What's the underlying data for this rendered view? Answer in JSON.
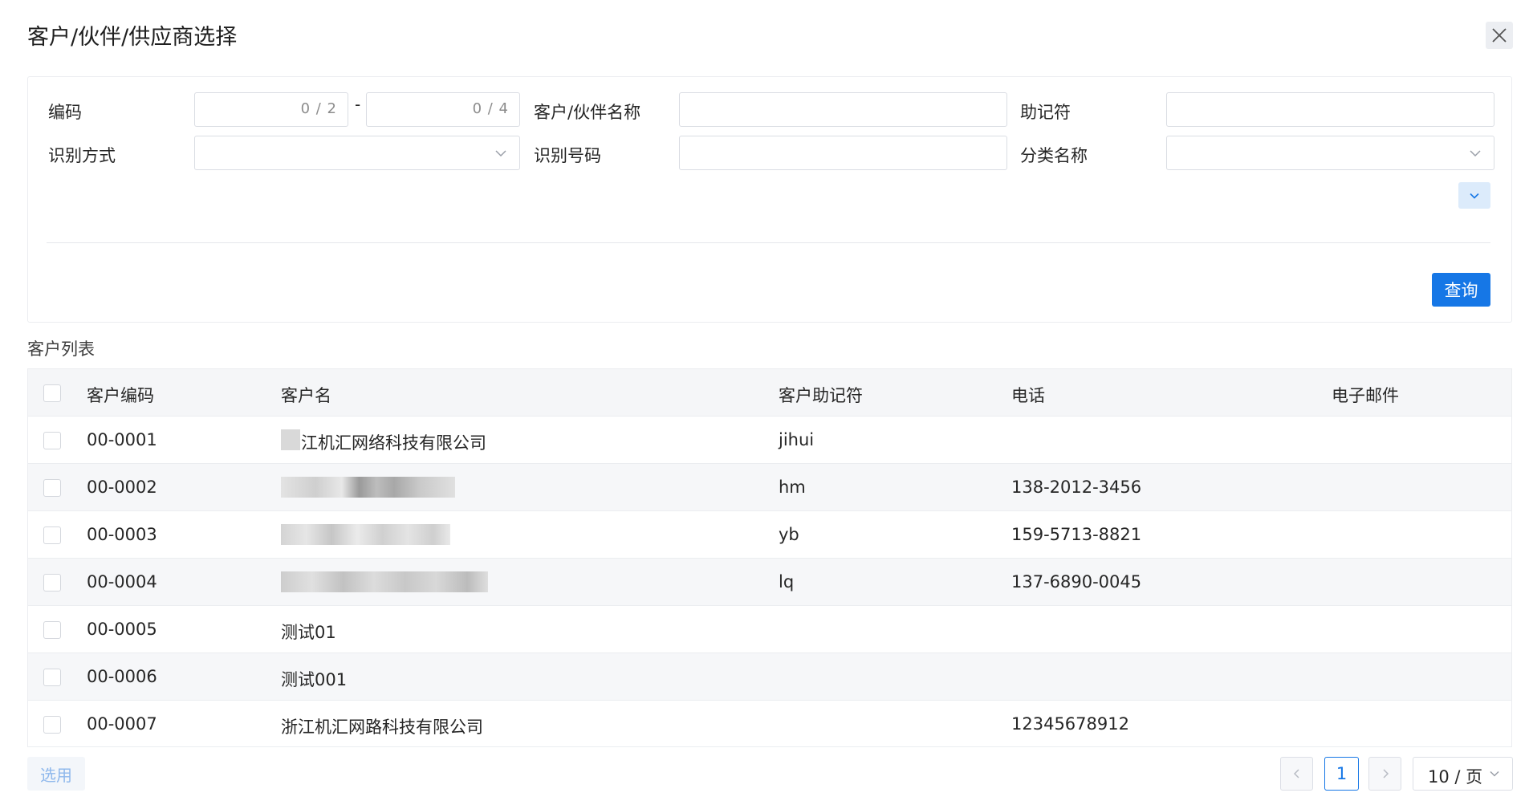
{
  "dialog": {
    "title": "客户/伙伴/供应商选择"
  },
  "filters": {
    "code_label": "编码",
    "code_from_count": "0 / 2",
    "code_separator": "-",
    "code_to_count": "0 / 4",
    "name_label": "客户/伙伴名称",
    "mnemonic_label": "助记符",
    "id_method_label": "识别方式",
    "id_number_label": "识别号码",
    "category_label": "分类名称",
    "query_button": "查询"
  },
  "table": {
    "section_title": "客户列表",
    "columns": [
      "客户编码",
      "客户名",
      "客户助记符",
      "电话",
      "电子邮件"
    ],
    "rows": [
      {
        "code": "00-0001",
        "name": "江机汇网络科技有限公司",
        "mnemonic": "jihui",
        "phone": "",
        "email": ""
      },
      {
        "code": "00-0002",
        "name": "",
        "mnemonic": "hm",
        "phone": "138-2012-3456",
        "email": ""
      },
      {
        "code": "00-0003",
        "name": "",
        "mnemonic": "yb",
        "phone": "159-5713-8821",
        "email": ""
      },
      {
        "code": "00-0004",
        "name": "",
        "mnemonic": "lq",
        "phone": "137-6890-0045",
        "email": ""
      },
      {
        "code": "00-0005",
        "name": "测试01",
        "mnemonic": "",
        "phone": "",
        "email": ""
      },
      {
        "code": "00-0006",
        "name": "测试001",
        "mnemonic": "",
        "phone": "",
        "email": ""
      },
      {
        "code": "00-0007",
        "name": "浙江机汇网路科技有限公司",
        "mnemonic": "",
        "phone": "12345678912",
        "email": ""
      }
    ]
  },
  "footer": {
    "select_button": "选用",
    "current_page": "1",
    "page_size": "10 / 页"
  },
  "colors": {
    "primary": "#1677e6",
    "header_bg": "#f5f6f8",
    "border": "#ebedf0"
  }
}
